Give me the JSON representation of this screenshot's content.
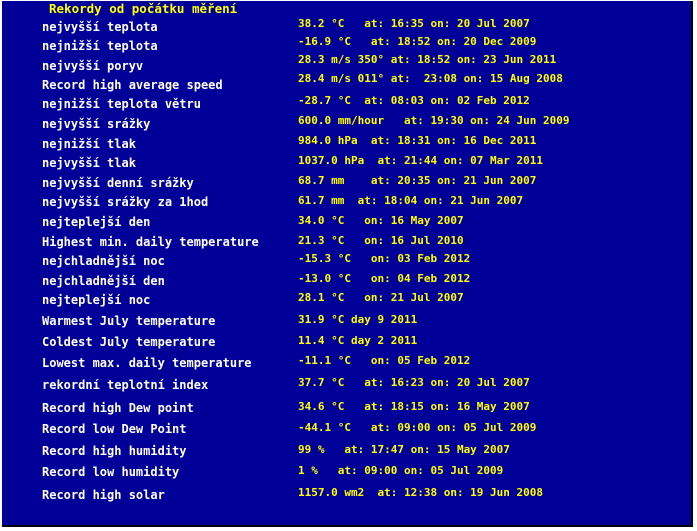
{
  "title": "Rekordy od počátku měření",
  "colors": {
    "background": "#000099",
    "label": "#ffffff",
    "value": "#ffff00"
  },
  "records": [
    {
      "label": "nejvyšší teplota",
      "value": "38.2 °C   at: 16:35 on: 20 Jul 2007"
    },
    {
      "label": "nejnižší teplota",
      "value": "-16.9 °C   at: 18:52 on: 20 Dec 2009"
    },
    {
      "label": "nejvyšší poryv",
      "value": "28.3 m/s 350° at: 18:52 on: 23 Jun 2011"
    },
    {
      "label": "Record high average speed",
      "value": "28.4 m/s 011° at:  23:08 on: 15 Aug 2008"
    },
    {
      "label": "nejnižší teplota větru",
      "value": "-28.7 °C  at: 08:03 on: 02 Feb 2012"
    },
    {
      "label": "nejvyšší srážky",
      "value": "600.0 mm/hour   at: 19:30 on: 24 Jun 2009"
    },
    {
      "label": "nejnižší tlak",
      "value": "984.0 hPa  at: 18:31 on: 16 Dec 2011"
    },
    {
      "label": "nejvyšší tlak",
      "value": "1037.0 hPa  at: 21:44 on: 07 Mar 2011"
    },
    {
      "label": "nejvyšší denní srážky",
      "value": "68.7 mm    at: 20:35 on: 21 Jun 2007"
    },
    {
      "label": "nejvyšší srážky za 1hod",
      "value": "61.7 mm  at: 18:04 on: 21 Jun 2007"
    },
    {
      "label": "nejteplejší den",
      "value": "34.0 °C   on: 16 May 2007"
    },
    {
      "label": "Highest min. daily temperature",
      "value": "21.3 °C   on: 16 Jul 2010"
    },
    {
      "label": "nejchladnější noc",
      "value": "-15.3 °C   on: 03 Feb 2012"
    },
    {
      "label": "nejchladnější den",
      "value": "-13.0 °C   on: 04 Feb 2012"
    },
    {
      "label": "nejteplejší noc",
      "value": "28.1 °C   on: 21 Jul 2007"
    },
    {
      "label": "Warmest July temperature",
      "value": "31.9 °C day 9 2011"
    },
    {
      "label": "Coldest July temperature",
      "value": "11.4 °C day 2 2011"
    },
    {
      "label": "Lowest max. daily temperature",
      "value": "-11.1 °C   on: 05 Feb 2012"
    },
    {
      "label": "rekordní teplotní index",
      "value": "37.7 °C   at: 16:23 on: 20 Jul 2007"
    },
    {
      "label": "Record high Dew point",
      "value": "34.6 °C   at: 18:15 on: 16 May 2007"
    },
    {
      "label": "Record low Dew Point",
      "value": "-44.1 °C   at: 09:00 on: 05 Jul 2009"
    },
    {
      "label": "Record high humidity",
      "value": "99 %   at: 17:47 on: 15 May 2007"
    },
    {
      "label": "Record low humidity",
      "value": "1 %   at: 09:00 on: 05 Jul 2009"
    },
    {
      "label": "Record high solar",
      "value": "1157.0 wm2  at: 12:38 on: 19 Jun 2008"
    }
  ]
}
